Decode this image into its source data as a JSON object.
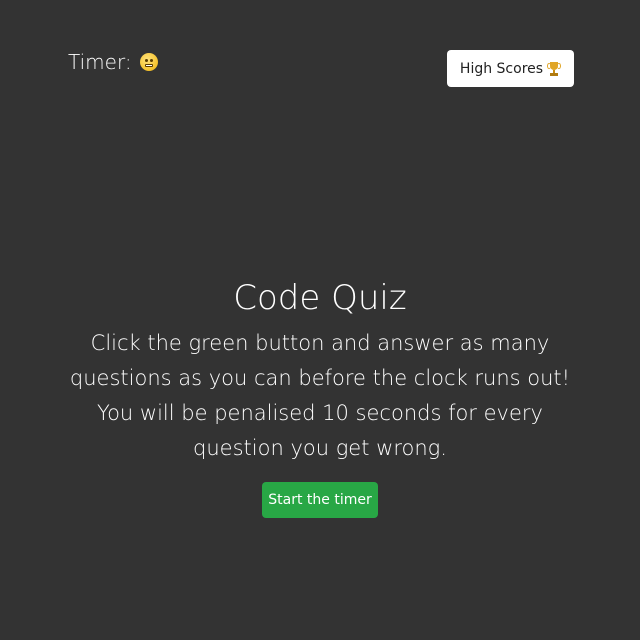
{
  "header": {
    "timer_label": "Timer:",
    "timer_icon": "grimacing-face-icon",
    "high_scores_label": "High Scores",
    "high_scores_icon": "trophy-icon"
  },
  "main": {
    "title": "Code Quiz",
    "instructions": "Click the green button and answer as many questions as you can before the clock runs out! You will be penalised 10 seconds for every question you get wrong.",
    "start_button_label": "Start the timer"
  },
  "colors": {
    "background": "#333333",
    "start_button": "#28a745",
    "high_scores_button": "#ffffff"
  }
}
